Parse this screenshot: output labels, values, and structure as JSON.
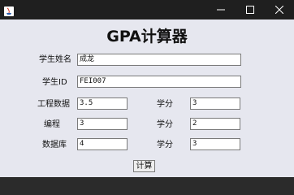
{
  "window": {
    "title": "",
    "controls": [
      "minimize-icon",
      "maximize-icon",
      "close-icon"
    ]
  },
  "heading": "GPA计算器",
  "form": {
    "name_label": "学生姓名",
    "name_value": "成龙",
    "id_label": "学生ID",
    "id_value": "FEI007",
    "courses": [
      {
        "label": "工程数据",
        "grade": "3.5",
        "credit_label": "学分",
        "credit": "3"
      },
      {
        "label": "编程",
        "grade": "3",
        "credit_label": "学分",
        "credit": "2"
      },
      {
        "label": "数据库",
        "grade": "4",
        "credit_label": "学分",
        "credit": "3"
      }
    ]
  },
  "actions": {
    "calculate_label": "计算"
  },
  "colors": {
    "titlebar": "#1f1f1f",
    "client": "#e6e7ef",
    "field_border": "#7a7a7a"
  }
}
